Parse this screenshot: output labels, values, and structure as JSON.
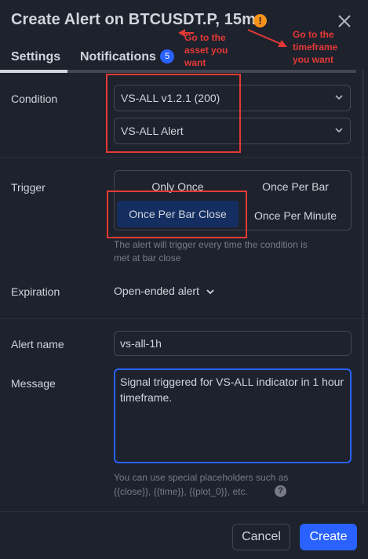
{
  "dialog": {
    "title": "Create Alert on BTCUSDT.P, 15m",
    "warning_glyph": "!",
    "close_glyph": "×"
  },
  "tabs": [
    {
      "label": "Settings",
      "active": true
    },
    {
      "label": "Notifications",
      "badge": "5"
    }
  ],
  "condition": {
    "label": "Condition",
    "primary": "VS-ALL v1.2.1 (200)",
    "secondary": "VS-ALL Alert"
  },
  "trigger": {
    "label": "Trigger",
    "options": [
      "Only Once",
      "Once Per Bar",
      "Once Per Bar Close",
      "Once Per Minute"
    ],
    "selected": "Once Per Bar Close",
    "hint_line1": "The alert will trigger every time the condition is",
    "hint_line2": "met at bar close"
  },
  "expiration": {
    "label": "Expiration",
    "value": "Open-ended alert"
  },
  "alert_name": {
    "label": "Alert name",
    "value": "vs-all-1h"
  },
  "message": {
    "label": "Message",
    "value": "Signal triggered for VS-ALL indicator in 1 hour timeframe.",
    "hint_line1": "You can use special placeholders such as",
    "hint_line2": "{{close}}, {{time}}, {{plot_0}}, etc."
  },
  "buttons": {
    "cancel": "Cancel",
    "create": "Create"
  },
  "annotations": {
    "asset": [
      "Go to the",
      "asset you",
      "want"
    ],
    "timeframe": [
      "Go to the",
      "timeframe",
      "you want"
    ]
  },
  "colors": {
    "background": "#1e222d",
    "accent": "#2962ff",
    "annotation": "#e53935",
    "warning": "#f7931a"
  }
}
